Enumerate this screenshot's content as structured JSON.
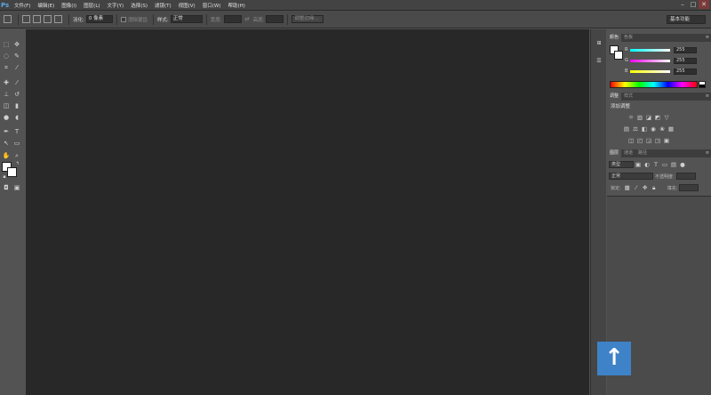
{
  "app": {
    "logo": "Ps",
    "menu": [
      "文件(F)",
      "编辑(E)",
      "图像(I)",
      "图层(L)",
      "文字(Y)",
      "选择(S)",
      "滤镜(T)",
      "视图(V)",
      "窗口(W)",
      "帮助(H)"
    ],
    "window_controls": [
      "–",
      "□",
      "✕"
    ]
  },
  "options": {
    "feather_label": "羽化:",
    "feather_value": "0 像素",
    "antialias_label": "消除锯齿",
    "style_label": "样式:",
    "style_value": "正常",
    "width_label": "宽度:",
    "height_label": "高度:",
    "refine_edge": "调整边缘...",
    "workspace": "基本功能"
  },
  "color_panel": {
    "tabs": [
      "颜色",
      "色板"
    ],
    "channels": [
      {
        "label": "R",
        "value": "255"
      },
      {
        "label": "G",
        "value": "255"
      },
      {
        "label": "B",
        "value": "255"
      }
    ]
  },
  "adjustments_panel": {
    "tabs": [
      "调整",
      "样式"
    ],
    "title": "添加调整",
    "row1": [
      "☼",
      "▥",
      "◪",
      "◩",
      "▽"
    ],
    "row2": [
      "▤",
      "⚖",
      "◧",
      "◉",
      "❀",
      "▦"
    ],
    "row3": [
      "◫",
      "◰",
      "◲",
      "◳",
      "▣"
    ]
  },
  "layers_panel": {
    "tabs": [
      "图层",
      "通道",
      "路径"
    ],
    "kind_label": "类型",
    "blend_mode": "正常",
    "opacity_label": "不透明度:",
    "lock_label": "锁定:",
    "fill_label": "填充:"
  },
  "overlay": {
    "up_arrow": "↑"
  },
  "colors": {
    "canvas_bg": "#282828",
    "ui_bg": "#535353",
    "accent_blue": "#3e83c7"
  }
}
